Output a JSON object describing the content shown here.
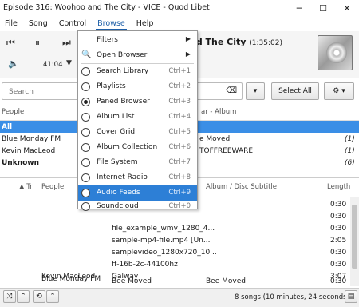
{
  "window": {
    "title": "Episode 316: Woohoo and The City - VICE - Quod Libet",
    "minimize": "─",
    "maximize": "☐",
    "close": "✕"
  },
  "menubar": [
    "File",
    "Song",
    "Control",
    "Browse",
    "Help"
  ],
  "player": {
    "elapsed": "41:04",
    "title": "nd The City",
    "duration": "(1:35:02)"
  },
  "search": {
    "placeholder": "Search",
    "select_all": "Select All"
  },
  "browser": {
    "left_header": "People",
    "right_header": "ar - Album",
    "people": [
      {
        "name": "All",
        "album": "",
        "count": ""
      },
      {
        "name": "Blue Monday FM",
        "album": "e Moved",
        "count": "(1)"
      },
      {
        "name": "Kevin MacLeod",
        "album": "TOFFREEWARE",
        "count": "(1)"
      },
      {
        "name": "Unknown",
        "album": "",
        "count": "(6)"
      }
    ]
  },
  "songlist": {
    "headers": {
      "tr": "Tr",
      "people": "People",
      "album": "Album / Disc Subtitle",
      "length": "Length"
    },
    "rows": [
      {
        "people": "",
        "title": "",
        "album": "",
        "length": "0:30"
      },
      {
        "people": "",
        "title": "",
        "album": "",
        "length": "0:30"
      },
      {
        "people": "",
        "title": "file_example_wmv_1280_4...",
        "album": "",
        "length": "0:30"
      },
      {
        "people": "",
        "title": "sample-mp4-file.mp4 [Un...",
        "album": "",
        "length": "2:05"
      },
      {
        "people": "",
        "title": "samplevideo_1280x720_10...",
        "album": "",
        "length": "0:30"
      },
      {
        "people": "",
        "title": "ff-16b-2c-44100hz",
        "album": "",
        "length": "0:30"
      },
      {
        "people": "Kevin MacLeod",
        "title": "Galway",
        "album": "",
        "length": "3:07"
      },
      {
        "people": "Blue Monday FM",
        "title": "Bee Moved",
        "album": "Bee Moved",
        "length": "0:30"
      }
    ]
  },
  "status": {
    "text": "8 songs (10 minutes, 24 seconds)"
  },
  "browse_menu": {
    "items": [
      {
        "label": "Filters",
        "accel": "",
        "submenu": true
      },
      {
        "label": "Open Browser",
        "accel": "",
        "submenu": true
      },
      {
        "label": "Search Library",
        "accel": "Ctrl+1"
      },
      {
        "label": "Playlists",
        "accel": "Ctrl+2"
      },
      {
        "label": "Paned Browser",
        "accel": "Ctrl+3",
        "checked": true
      },
      {
        "label": "Album List",
        "accel": "Ctrl+4"
      },
      {
        "label": "Cover Grid",
        "accel": "Ctrl+5"
      },
      {
        "label": "Album Collection",
        "accel": "Ctrl+6"
      },
      {
        "label": "File System",
        "accel": "Ctrl+7"
      },
      {
        "label": "Internet Radio",
        "accel": "Ctrl+8"
      },
      {
        "label": "Audio Feeds",
        "accel": "Ctrl+9",
        "highlighted": true
      },
      {
        "label": "Soundcloud",
        "accel": "Ctrl+0"
      }
    ]
  },
  "colors": {
    "accent": "#2d7fd6",
    "selection": "#3a8ee6"
  }
}
